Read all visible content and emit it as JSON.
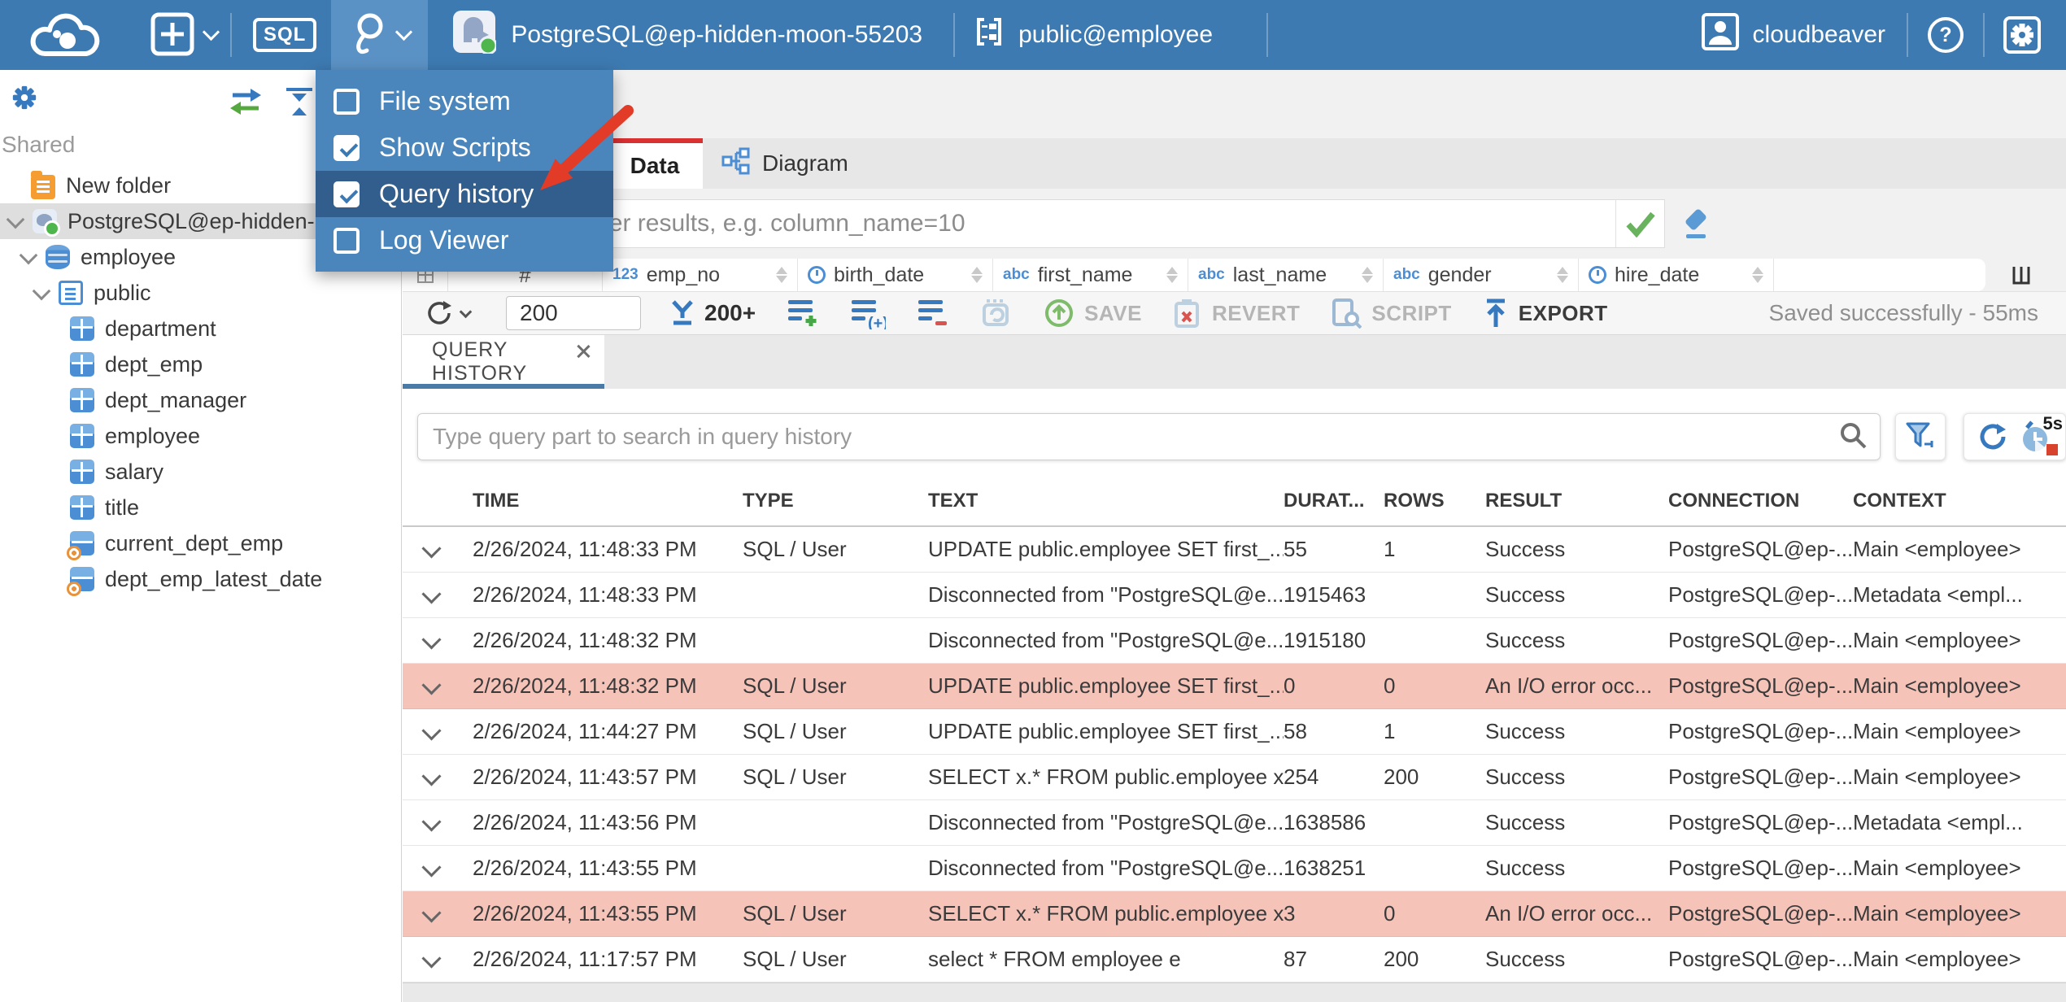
{
  "colors": {
    "topbar": "#3d7ab1",
    "menu": "#4a85bb",
    "menu_active": "#315e8d",
    "tab_red": "#d93032",
    "error_row": "#f6c3b9",
    "accent_blue": "#3779be",
    "status_green": "#4eb64c"
  },
  "topbar": {
    "sql_label": "SQL",
    "connection_label": "PostgreSQL@ep-hidden-moon-55203",
    "schema_label": "public@employee",
    "username": "cloudbeaver"
  },
  "tools_menu": {
    "items": [
      {
        "label": "File system",
        "checked": false,
        "active": false
      },
      {
        "label": "Show Scripts",
        "checked": true,
        "active": false
      },
      {
        "label": "Query history",
        "checked": true,
        "active": true
      },
      {
        "label": "Log Viewer",
        "checked": false,
        "active": false
      }
    ]
  },
  "sidebar": {
    "section_label": "Shared",
    "tree": [
      {
        "label": "New folder",
        "type": "folder",
        "indent": 38,
        "chevron": false,
        "selected": false
      },
      {
        "label": "PostgreSQL@ep-hidden-",
        "type": "connection",
        "indent": 6,
        "chevron": true,
        "selected": true
      },
      {
        "label": "employee",
        "type": "database",
        "indent": 22,
        "chevron": true,
        "selected": false
      },
      {
        "label": "public",
        "type": "schema",
        "indent": 38,
        "chevron": true,
        "selected": false
      },
      {
        "label": "department",
        "type": "table",
        "indent": 86,
        "chevron": false,
        "selected": false
      },
      {
        "label": "dept_emp",
        "type": "table",
        "indent": 86,
        "chevron": false,
        "selected": false
      },
      {
        "label": "dept_manager",
        "type": "table",
        "indent": 86,
        "chevron": false,
        "selected": false
      },
      {
        "label": "employee",
        "type": "table",
        "indent": 86,
        "chevron": false,
        "selected": false
      },
      {
        "label": "salary",
        "type": "table",
        "indent": 86,
        "chevron": false,
        "selected": false
      },
      {
        "label": "title",
        "type": "table",
        "indent": 86,
        "chevron": false,
        "selected": false
      },
      {
        "label": "current_dept_emp",
        "type": "view",
        "indent": 86,
        "chevron": false,
        "selected": false
      },
      {
        "label": "dept_emp_latest_date",
        "type": "view",
        "indent": 86,
        "chevron": false,
        "selected": false
      }
    ]
  },
  "data_tabs": {
    "data_label": "Data",
    "diagram_label": "Diagram"
  },
  "filter": {
    "placeholder": "expression to filter results, e.g. column_name=10"
  },
  "grid": {
    "row_header": "#",
    "columns": [
      {
        "icon": "num",
        "label": "emp_no"
      },
      {
        "icon": "clock",
        "label": "birth_date"
      },
      {
        "icon": "abc",
        "label": "first_name"
      },
      {
        "icon": "abc",
        "label": "last_name"
      },
      {
        "icon": "abc",
        "label": "gender"
      },
      {
        "icon": "clock",
        "label": "hire_date"
      }
    ]
  },
  "toolbar": {
    "row_limit": "200",
    "fetch_label": "200+",
    "save_label": "SAVE",
    "revert_label": "REVERT",
    "script_label": "SCRIPT",
    "export_label": "EXPORT",
    "status": "Saved successfully - 55ms"
  },
  "query_history": {
    "tab_label": "QUERY HISTORY",
    "search_placeholder": "Type query part to search in query history",
    "timer_label": "5s",
    "columns": [
      "TIME",
      "TYPE",
      "TEXT",
      "DURAT...",
      "ROWS",
      "RESULT",
      "CONNECTION",
      "CONTEXT"
    ],
    "rows": [
      {
        "time": "2/26/2024, 11:48:33 PM",
        "type": "SQL / User",
        "text": "UPDATE public.employee SET first_...",
        "duration": "55",
        "rows": "1",
        "result": "Success",
        "connection": "PostgreSQL@ep-...",
        "context": "Main <employee>",
        "error": false
      },
      {
        "time": "2/26/2024, 11:48:33 PM",
        "type": "",
        "text": "Disconnected from \"PostgreSQL@e...",
        "duration": "1915463",
        "rows": "",
        "result": "Success",
        "connection": "PostgreSQL@ep-...",
        "context": "Metadata <empl...",
        "error": false
      },
      {
        "time": "2/26/2024, 11:48:32 PM",
        "type": "",
        "text": "Disconnected from \"PostgreSQL@e...",
        "duration": "1915180",
        "rows": "",
        "result": "Success",
        "connection": "PostgreSQL@ep-...",
        "context": "Main <employee>",
        "error": false
      },
      {
        "time": "2/26/2024, 11:48:32 PM",
        "type": "SQL / User",
        "text": "UPDATE public.employee SET first_...",
        "duration": "0",
        "rows": "0",
        "result": "An I/O error occ...",
        "connection": "PostgreSQL@ep-...",
        "context": "Main <employee>",
        "error": true
      },
      {
        "time": "2/26/2024, 11:44:27 PM",
        "type": "SQL / User",
        "text": "UPDATE public.employee SET first_...",
        "duration": "58",
        "rows": "1",
        "result": "Success",
        "connection": "PostgreSQL@ep-...",
        "context": "Main <employee>",
        "error": false
      },
      {
        "time": "2/26/2024, 11:43:57 PM",
        "type": "SQL / User",
        "text": "SELECT x.* FROM public.employee x",
        "duration": "254",
        "rows": "200",
        "result": "Success",
        "connection": "PostgreSQL@ep-...",
        "context": "Main <employee>",
        "error": false
      },
      {
        "time": "2/26/2024, 11:43:56 PM",
        "type": "",
        "text": "Disconnected from \"PostgreSQL@e...",
        "duration": "1638586",
        "rows": "",
        "result": "Success",
        "connection": "PostgreSQL@ep-...",
        "context": "Metadata <empl...",
        "error": false
      },
      {
        "time": "2/26/2024, 11:43:55 PM",
        "type": "",
        "text": "Disconnected from \"PostgreSQL@e...",
        "duration": "1638251",
        "rows": "",
        "result": "Success",
        "connection": "PostgreSQL@ep-...",
        "context": "Main <employee>",
        "error": false
      },
      {
        "time": "2/26/2024, 11:43:55 PM",
        "type": "SQL / User",
        "text": "SELECT x.* FROM public.employee x",
        "duration": "3",
        "rows": "0",
        "result": "An I/O error occ...",
        "connection": "PostgreSQL@ep-...",
        "context": "Main <employee>",
        "error": true
      },
      {
        "time": "2/26/2024, 11:17:57 PM",
        "type": "SQL / User",
        "text": "select * FROM employee e",
        "duration": "87",
        "rows": "200",
        "result": "Success",
        "connection": "PostgreSQL@ep-...",
        "context": "Main <employee>",
        "error": false
      }
    ]
  }
}
